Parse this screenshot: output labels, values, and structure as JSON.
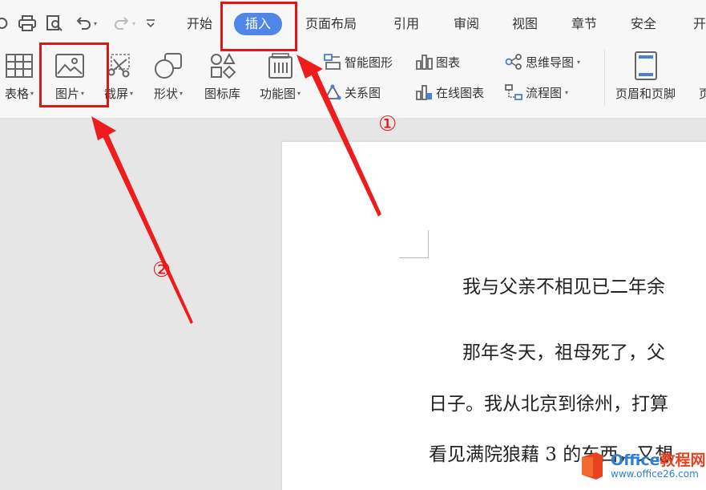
{
  "ribbon": {
    "tabs": [
      {
        "label": "开始"
      },
      {
        "label": "插入"
      },
      {
        "label": "页面布局"
      },
      {
        "label": "引用"
      },
      {
        "label": "审阅"
      },
      {
        "label": "视图"
      },
      {
        "label": "章节"
      },
      {
        "label": "安全"
      },
      {
        "label": "开"
      }
    ],
    "tools": {
      "table": "表格",
      "picture": "图片",
      "screenshot": "截屏",
      "shape": "形状",
      "icon_library": "图标库",
      "function_chart": "功能图",
      "smart_graphic": "智能图形",
      "chart": "图表",
      "mind_map": "思维导图",
      "relation_chart": "关系图",
      "online_chart": "在线图表",
      "flowchart": "流程图",
      "header_footer": "页眉和页脚",
      "more": "页"
    }
  },
  "document": {
    "lines": [
      "我与父亲不相见已二年余",
      "那年冬天，祖母死了，父",
      "日子。我从北京到徐州，打算",
      "看见满院狼藉 3 的东西，又想"
    ]
  },
  "annotations": {
    "step1": "①",
    "step2": "②"
  },
  "watermark": {
    "brand_en": "Office",
    "brand_cn": "教程网",
    "url": "www.office26.com"
  },
  "colors": {
    "active_tab": "#4f86e8",
    "annotation_red": "#e31414"
  }
}
